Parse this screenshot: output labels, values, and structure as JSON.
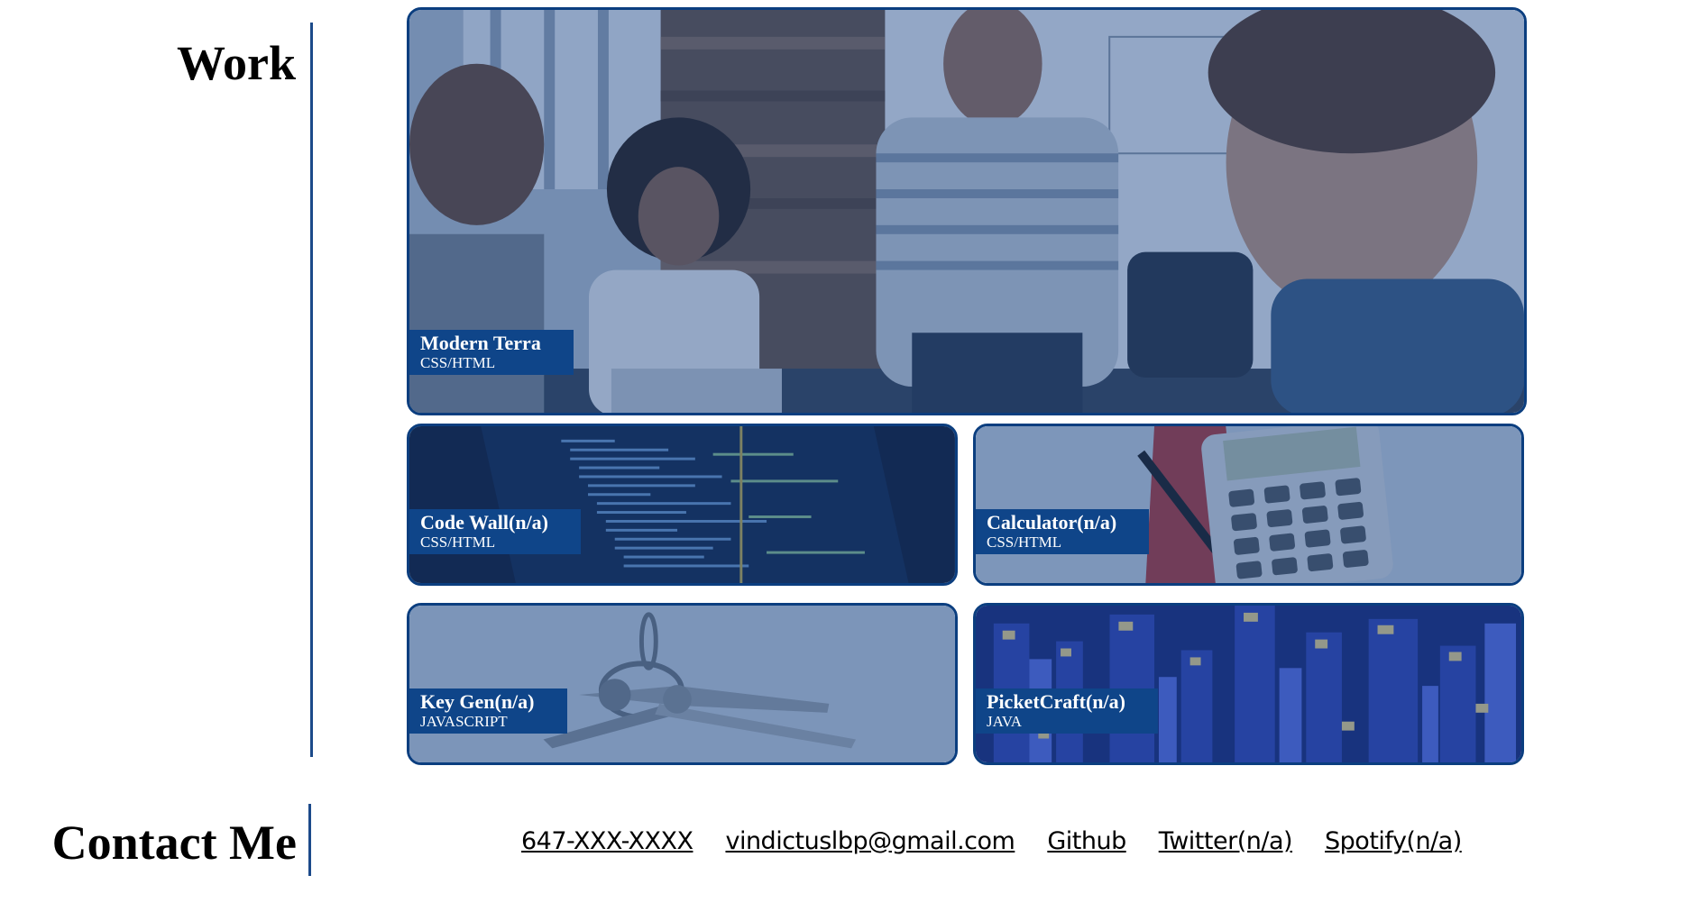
{
  "work": {
    "title": "Work",
    "projects": [
      {
        "name": "Modern Terra",
        "tech": "CSS/HTML",
        "image": "team-meeting-photo"
      },
      {
        "name": "Code Wall(n/a)",
        "tech": "CSS/HTML",
        "image": "code-screen-photo"
      },
      {
        "name": "Calculator(n/a)",
        "tech": "CSS/HTML",
        "image": "calculator-photo"
      },
      {
        "name": "Key Gen(n/a)",
        "tech": "JAVASCRIPT",
        "image": "keys-photo"
      },
      {
        "name": "PicketCraft(n/a)",
        "tech": "JAVA",
        "image": "voxel-city-photo"
      }
    ]
  },
  "contact": {
    "title": "Contact Me",
    "links": [
      {
        "label": "647-XXX-XXXX"
      },
      {
        "label": "vindictuslbp@gmail.com"
      },
      {
        "label": "Github"
      },
      {
        "label": "Twitter(n/a)"
      },
      {
        "label": "Spotify(n/a)"
      }
    ]
  },
  "colors": {
    "accent": "#0f4589",
    "border": "#0b3e7f",
    "overlay": "#164082",
    "text": "#000000",
    "background": "#ffffff"
  }
}
